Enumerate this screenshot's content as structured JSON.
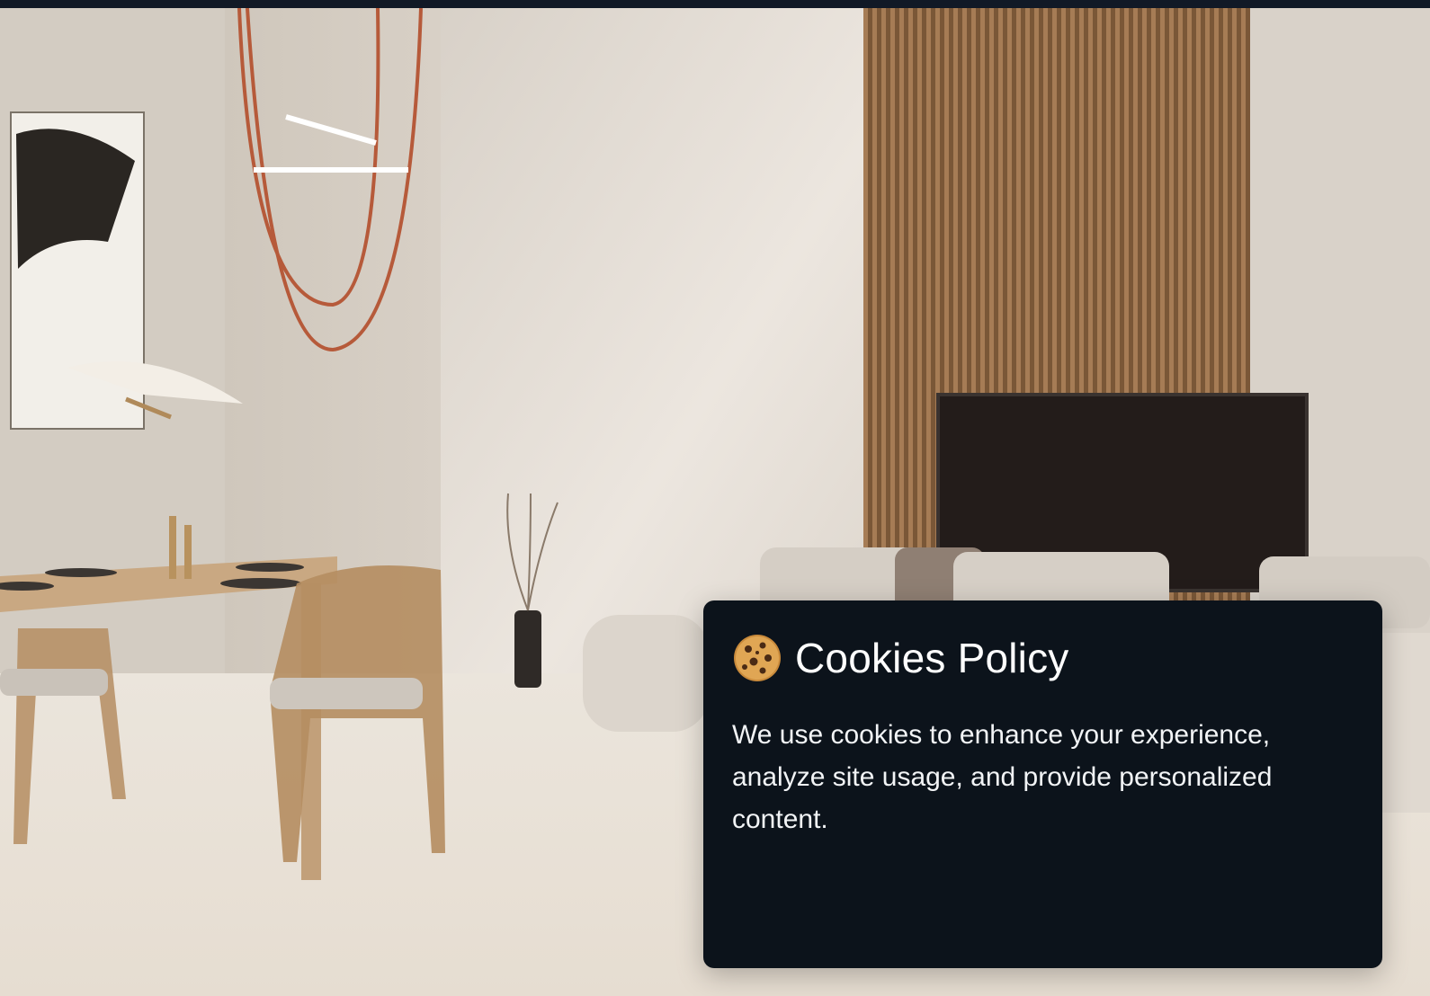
{
  "cookie_banner": {
    "title": "Cookies Policy",
    "icon": "cookie-icon",
    "text": "We use cookies to enhance your experience, analyze site usage, and provide personalized content."
  },
  "colors": {
    "top_bar": "#111926",
    "banner_background": "#0c131b",
    "banner_text": "#ffffff"
  }
}
